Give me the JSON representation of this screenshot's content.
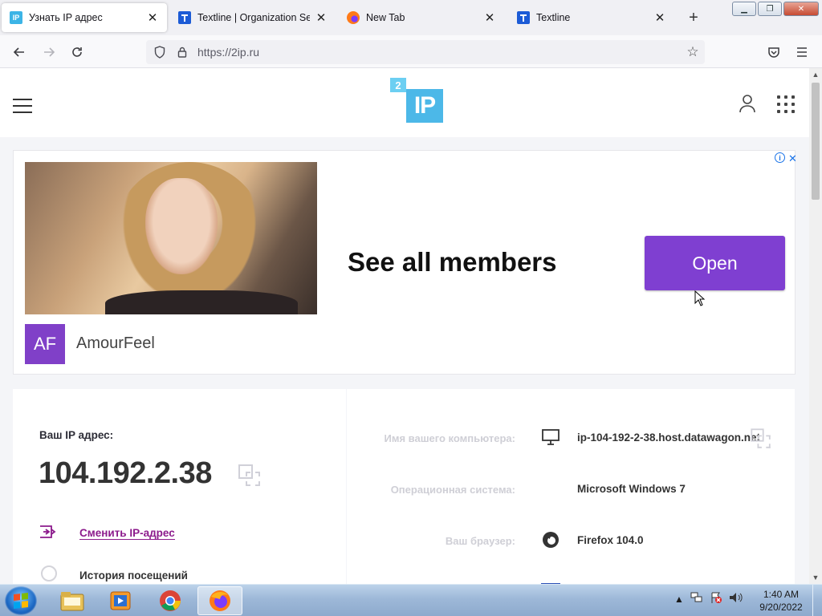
{
  "browser": {
    "tabs": [
      {
        "title": "Узнать IP адрес",
        "favicon": "2ip-icon",
        "active": true
      },
      {
        "title": "Textline | Organization Settings",
        "favicon": "textline-icon",
        "active": false
      },
      {
        "title": "New Tab",
        "favicon": "firefox-icon",
        "active": false
      },
      {
        "title": "Textline",
        "favicon": "textline-icon",
        "active": false
      }
    ],
    "url": "https://2ip.ru"
  },
  "site": {
    "logo_small": "2",
    "logo_big": "IP"
  },
  "ad": {
    "headline": "See all members",
    "button_label": "Open",
    "avatar_initials": "AF",
    "brand_name": "AmourFeel",
    "accent_color": "#7f3fd1"
  },
  "ip_card": {
    "label": "Ваш IP адрес:",
    "ip": "104.192.2.38",
    "change_ip_link": "Сменить IP-адрес",
    "history_label": "История посещений"
  },
  "info": {
    "rows": [
      {
        "key": "Имя вашего компьютера:",
        "value": "ip-104-192-2-38.host.datawagon.net",
        "icon": "monitor-icon"
      },
      {
        "key": "Операционная система:",
        "value": "Microsoft Windows 7",
        "icon": "windows-icon"
      },
      {
        "key": "Ваш браузер:",
        "value": "Firefox 104.0",
        "icon": "firefox-icon"
      }
    ]
  },
  "taskbar": {
    "time": "1:40 AM",
    "date": "9/20/2022",
    "apps": [
      "explorer-icon",
      "media-player-icon",
      "chrome-icon",
      "firefox-icon"
    ]
  }
}
